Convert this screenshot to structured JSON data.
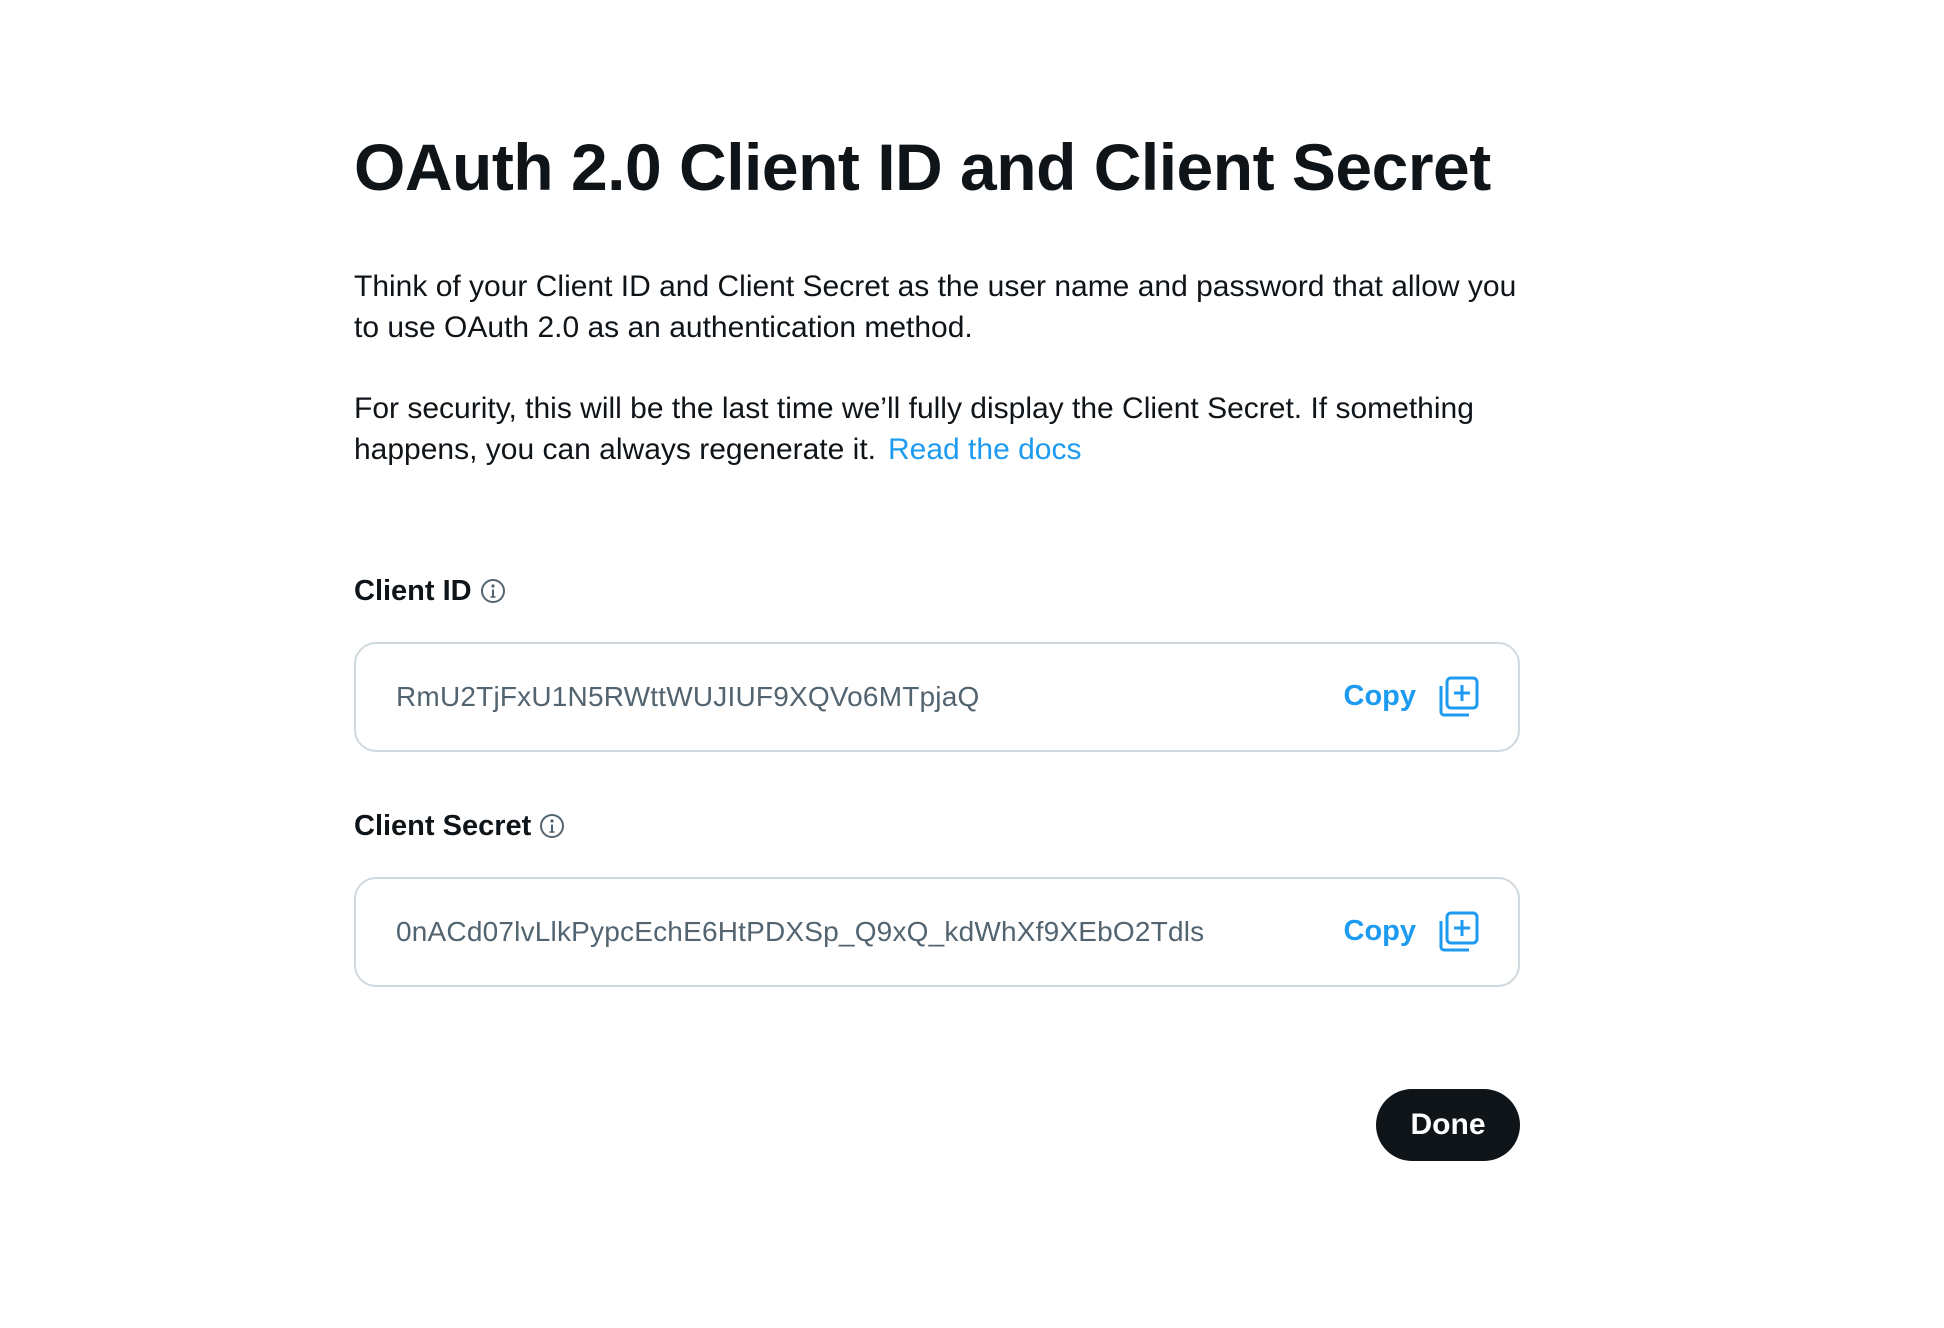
{
  "dialog": {
    "title": "OAuth 2.0 Client ID and Client Secret",
    "intro": "Think of your Client ID and Client Secret as the user name and password that allow you to use OAuth 2.0 as an authentication method.",
    "security_note": "For security, this will be the last time we’ll fully display the Client Secret. If something happens, you can always regenerate it.",
    "docs_link": "Read the docs"
  },
  "client_id": {
    "label": "Client ID",
    "value": "RmU2TjFxU1N5RWttWUJIUF9XQVo6MTpjaQ",
    "copy_label": "Copy",
    "icon": "info-icon"
  },
  "client_secret": {
    "label": "Client Secret",
    "value": "0nACd07lvLlkPypcEchE6HtPDXSp_Q9xQ_kdWhXf9XEbO2Tdls",
    "copy_label": "Copy",
    "icon": "info-icon"
  },
  "actions": {
    "done_label": "Done"
  },
  "colors": {
    "accent": "#1d9bf0",
    "text": "#0f1419",
    "muted": "#536471",
    "border": "#cfd9de"
  }
}
